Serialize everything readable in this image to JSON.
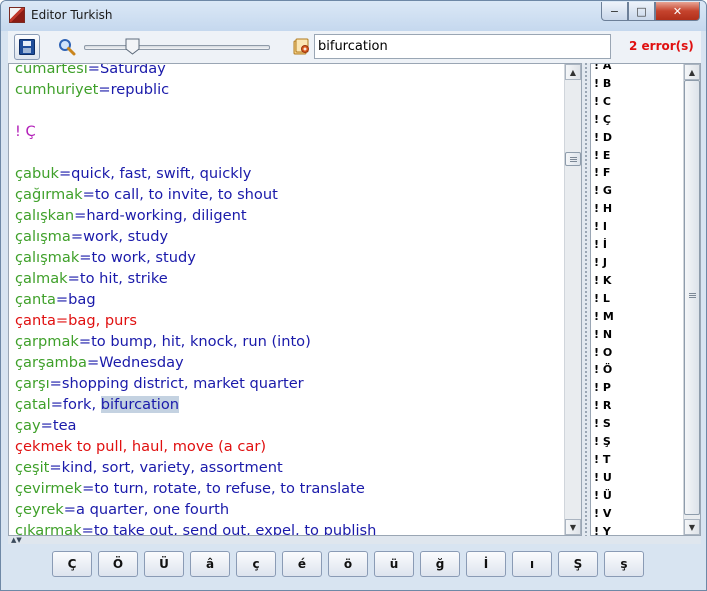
{
  "window": {
    "title": "Editor Turkish",
    "min_glyph": "−",
    "max_glyph": "□",
    "close_glyph": "✕"
  },
  "toolbar": {
    "search_value": "bifurcation",
    "zoom_level": 0.24,
    "error_count": "2 error(s)"
  },
  "editor_lines": [
    {
      "word": "cumartesi",
      "def": "Saturday",
      "kind": "ok"
    },
    {
      "word": "cumhuriyet",
      "def": "republic",
      "kind": "ok"
    },
    {
      "blank": true
    },
    {
      "header": "! Ç"
    },
    {
      "blank": true
    },
    {
      "word": "çabuk",
      "def": "quick, fast, swift, quickly",
      "kind": "ok"
    },
    {
      "word": "çağırmak",
      "def": "to call, to invite, to shout",
      "kind": "ok"
    },
    {
      "word": "çalışkan",
      "def": "hard-working, diligent",
      "kind": "ok"
    },
    {
      "word": "çalışma",
      "def": "work, study",
      "kind": "ok"
    },
    {
      "word": "çalışmak",
      "def": "to work, study",
      "kind": "ok"
    },
    {
      "word": "çalmak",
      "def": "to hit, strike",
      "kind": "ok"
    },
    {
      "word": "çanta",
      "def": "bag",
      "kind": "ok"
    },
    {
      "word": "çanta",
      "def": "bag, purs",
      "kind": "error"
    },
    {
      "word": "çarpmak",
      "def": "to bump, hit, knock, run (into)",
      "kind": "ok"
    },
    {
      "word": "çarşamba",
      "def": "Wednesday",
      "kind": "ok"
    },
    {
      "word": "çarşı",
      "def": "shopping district, market quarter",
      "kind": "ok"
    },
    {
      "word": "çatal",
      "def": "fork, ",
      "highlight": "bifurcation",
      "kind": "ok"
    },
    {
      "word": "çay",
      "def": "tea",
      "kind": "ok"
    },
    {
      "text": "çekmek to pull, haul, move (a car)",
      "kind": "error"
    },
    {
      "word": "çeşit",
      "def": "kind, sort, variety, assortment",
      "kind": "ok"
    },
    {
      "word": "çevirmek",
      "def": "to turn, rotate, to refuse, to translate",
      "kind": "ok"
    },
    {
      "word": "çeyrek",
      "def": "a quarter, one fourth",
      "kind": "ok"
    },
    {
      "word": "çıkarmak",
      "def": "to take out, send out, expel, to publish",
      "kind": "ok"
    }
  ],
  "index_items": [
    "! A",
    "! B",
    "! C",
    "! Ç",
    "! D",
    "! E",
    "! F",
    "! G",
    "! H",
    "! I",
    "! İ",
    "! J",
    "! K",
    "! L",
    "! M",
    "! N",
    "! O",
    "! Ö",
    "! P",
    "! R",
    "! S",
    "! Ş",
    "! T",
    "! U",
    "! Ü",
    "! V",
    "! Y"
  ],
  "char_buttons": [
    "Ç",
    "Ö",
    "Ü",
    "â",
    "ç",
    "é",
    "ö",
    "ü",
    "ğ",
    "İ",
    "ı",
    "Ş",
    "ş"
  ],
  "colors": {
    "word": "#3fa02a",
    "definition": "#1a1aaa",
    "error": "#e01010",
    "header": "#b21fb8",
    "highlight": "#c4d2e1"
  }
}
